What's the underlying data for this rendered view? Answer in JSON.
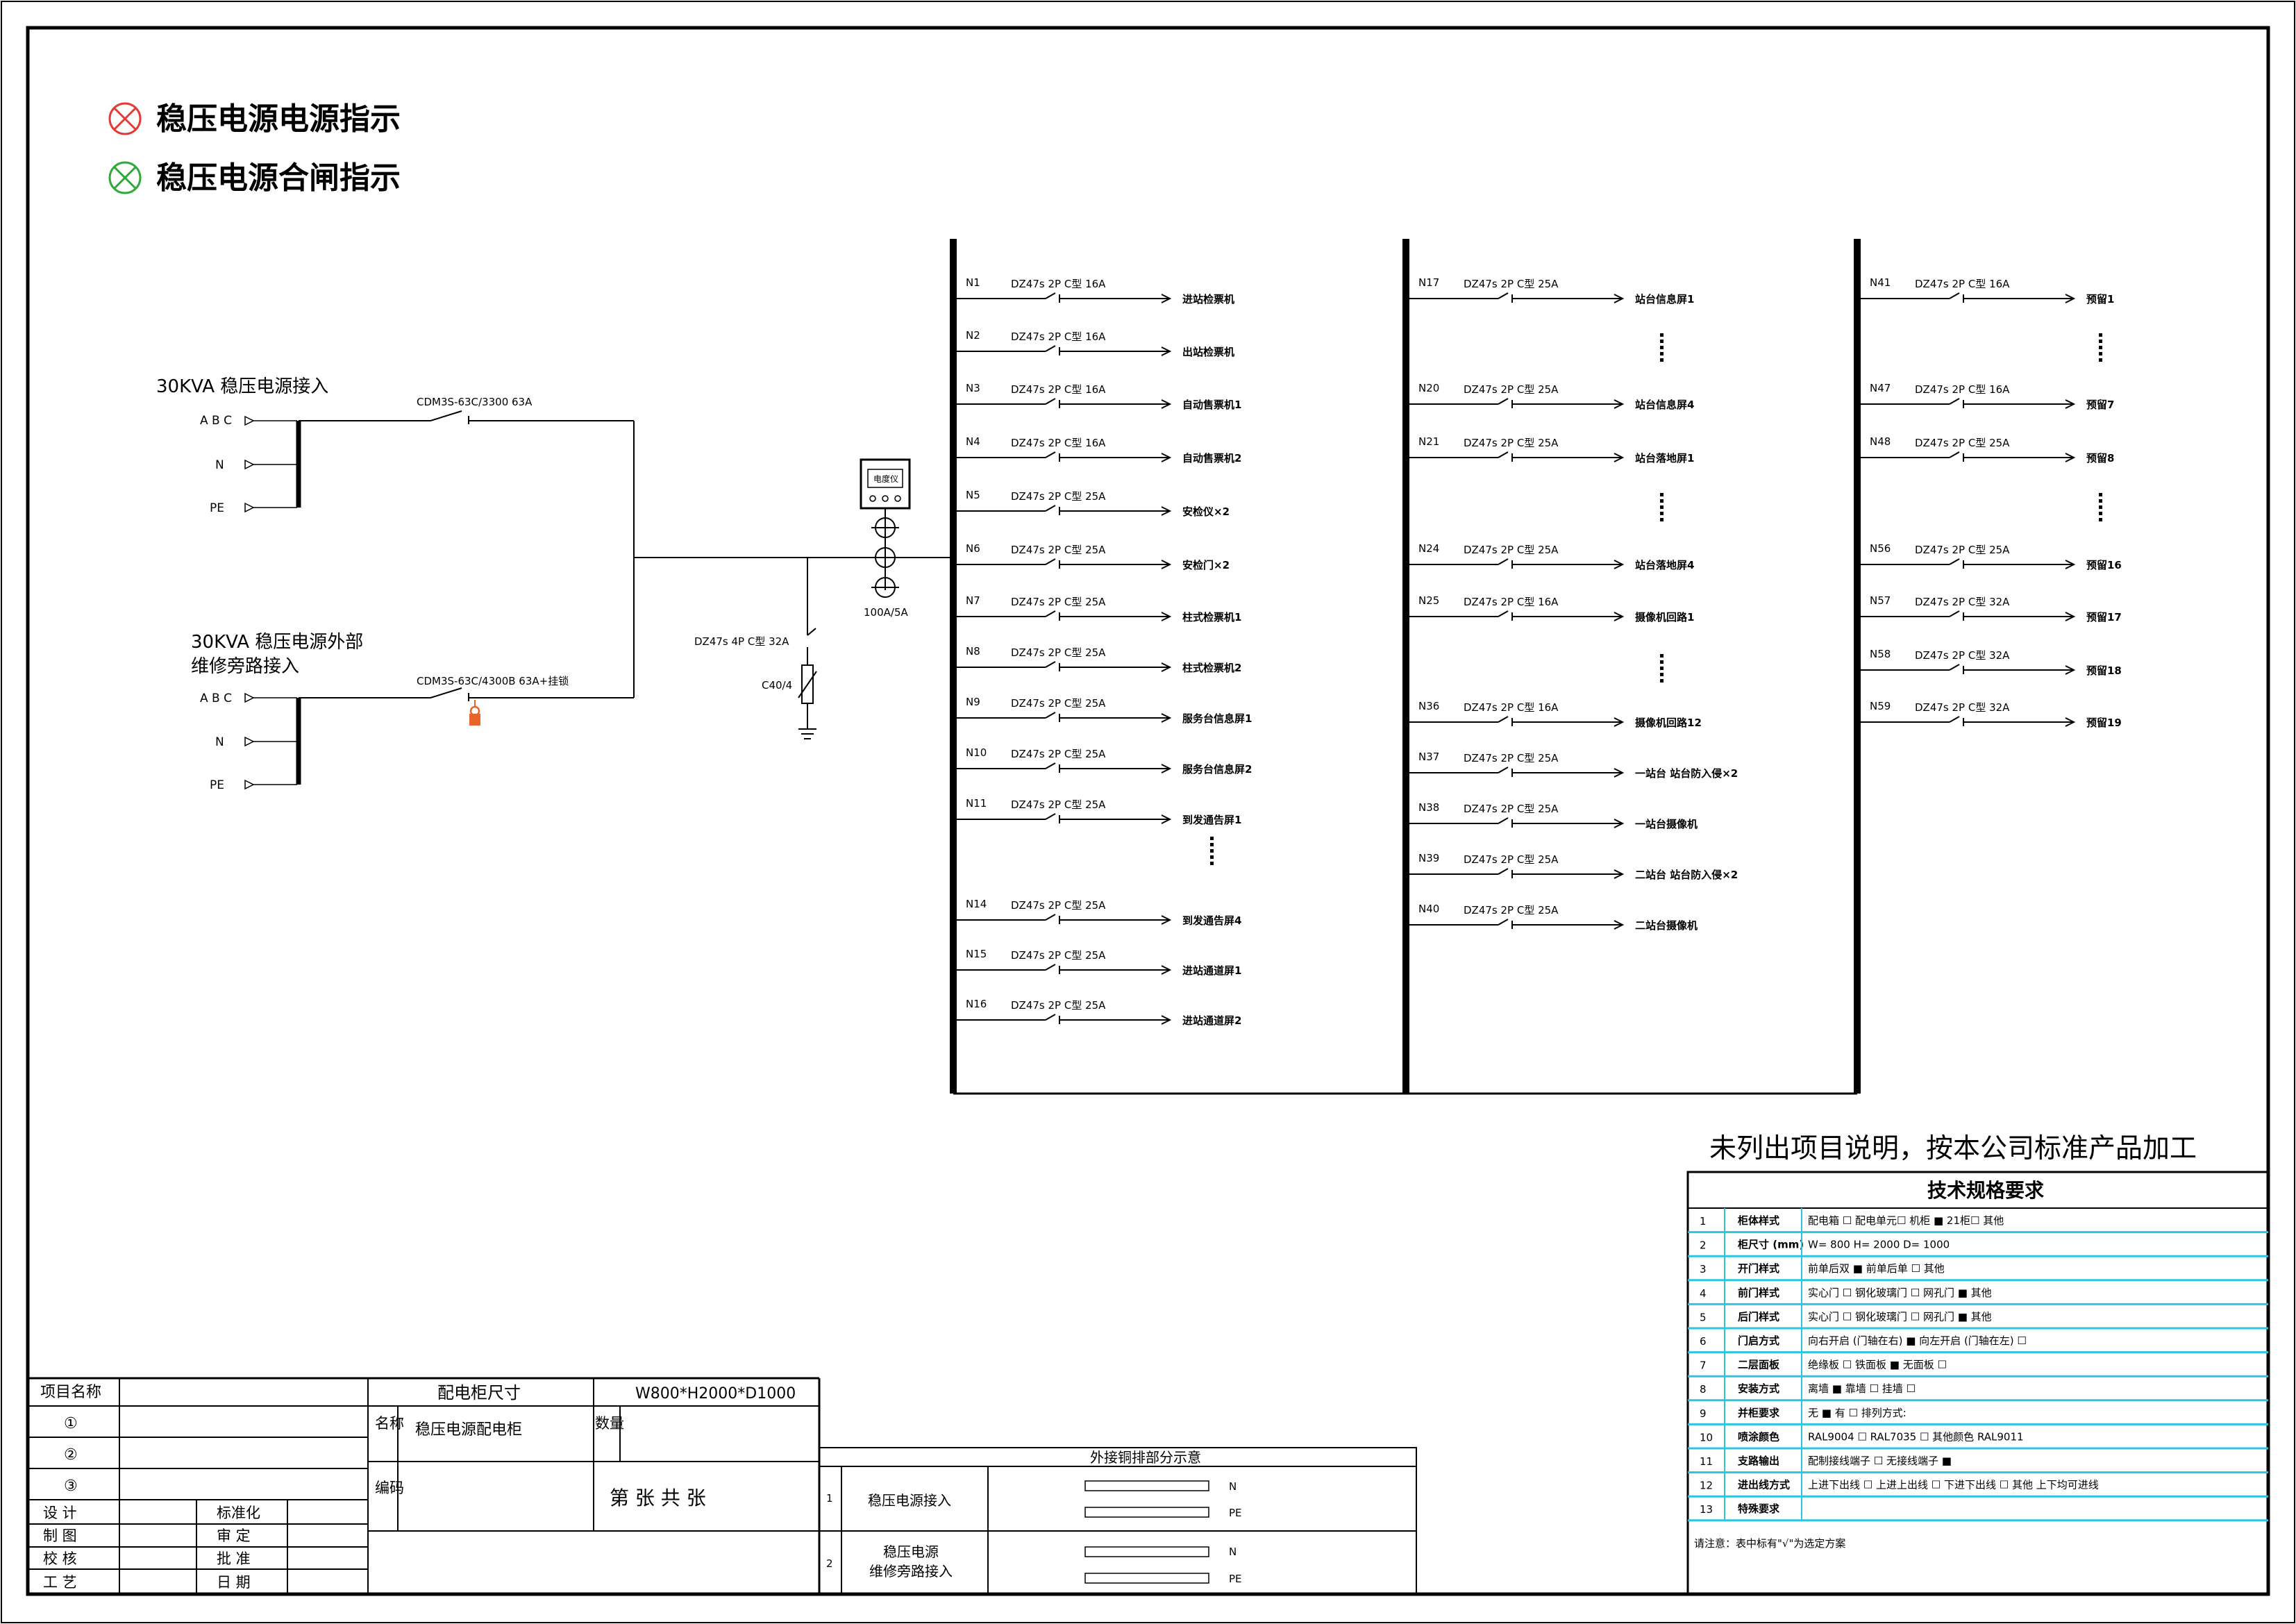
{
  "legend": [
    {
      "label": "稳压电源电源指示",
      "color": "#e53935"
    },
    {
      "label": "稳压电源合闸指示",
      "color": "#2eaa3a"
    }
  ],
  "sources": {
    "main_label": "30KVA 稳压电源接入",
    "bypass_label_line1": "30KVA 稳压电源外部",
    "bypass_label_line2": "维修旁路接入",
    "phase_abc": "A B C",
    "phase_n": "N",
    "phase_pe": "PE",
    "main_breaker": "CDM3S-63C/3300 63A",
    "bypass_breaker": "CDM3S-63C/4300B 63A+挂锁"
  },
  "spd": {
    "breaker": "DZ47s 4P C型 32A",
    "arrester": "C40/4"
  },
  "meter": {
    "label": "电度仪",
    "ct": "100A/5A"
  },
  "columns": [
    [
      {
        "id": "N1",
        "spec": "DZ47s  2P C型 16A",
        "label": "进站检票机"
      },
      {
        "id": "N2",
        "spec": "DZ47s  2P C型 16A",
        "label": "出站检票机"
      },
      {
        "id": "N3",
        "spec": "DZ47s  2P C型 16A",
        "label": "自动售票机1"
      },
      {
        "id": "N4",
        "spec": "DZ47s  2P C型 16A",
        "label": "自动售票机2"
      },
      {
        "id": "N5",
        "spec": "DZ47s  2P C型 25A",
        "label": "安检仪×2"
      },
      {
        "id": "N6",
        "spec": "DZ47s  2P C型 25A",
        "label": "安检门×2"
      },
      {
        "id": "N7",
        "spec": "DZ47s  2P C型 25A",
        "label": "柱式检票机1"
      },
      {
        "id": "N8",
        "spec": "DZ47s  2P C型 25A",
        "label": "柱式检票机2"
      },
      {
        "id": "N9",
        "spec": "DZ47s  2P C型 25A",
        "label": "服务台信息屏1"
      },
      {
        "id": "N10",
        "spec": "DZ47s  2P C型 25A",
        "label": "服务台信息屏2"
      },
      {
        "id": "N11",
        "spec": "DZ47s  2P C型 25A",
        "label": "到发通告屏1"
      },
      {
        "id": "N14",
        "spec": "DZ47s  2P C型 25A",
        "label": "到发通告屏4"
      },
      {
        "id": "N15",
        "spec": "DZ47s  2P C型 25A",
        "label": "进站通道屏1"
      },
      {
        "id": "N16",
        "spec": "DZ47s  2P C型 25A",
        "label": "进站通道屏2"
      }
    ],
    [
      {
        "id": "N17",
        "spec": "DZ47s  2P C型 25A",
        "label": "站台信息屏1"
      },
      {
        "id": "N20",
        "spec": "DZ47s  2P C型 25A",
        "label": "站台信息屏4"
      },
      {
        "id": "N21",
        "spec": "DZ47s  2P C型 25A",
        "label": "站台落地屏1"
      },
      {
        "id": "N24",
        "spec": "DZ47s  2P C型 25A",
        "label": "站台落地屏4"
      },
      {
        "id": "N25",
        "spec": "DZ47s  2P C型 16A",
        "label": "摄像机回路1"
      },
      {
        "id": "N36",
        "spec": "DZ47s  2P C型 16A",
        "label": "摄像机回路12"
      },
      {
        "id": "N37",
        "spec": "DZ47s  2P C型 25A",
        "label": "一站台 站台防入侵×2"
      },
      {
        "id": "N38",
        "spec": "DZ47s  2P C型 25A",
        "label": "一站台摄像机"
      },
      {
        "id": "N39",
        "spec": "DZ47s  2P C型 25A",
        "label": "二站台 站台防入侵×2"
      },
      {
        "id": "N40",
        "spec": "DZ47s  2P C型 25A",
        "label": "二站台摄像机"
      }
    ],
    [
      {
        "id": "N41",
        "spec": "DZ47s  2P C型 16A",
        "label": "预留1"
      },
      {
        "id": "N47",
        "spec": "DZ47s  2P C型 16A",
        "label": "预留7"
      },
      {
        "id": "N48",
        "spec": "DZ47s  2P C型 25A",
        "label": "预留8"
      },
      {
        "id": "N56",
        "spec": "DZ47s  2P C型 25A",
        "label": "预留16"
      },
      {
        "id": "N57",
        "spec": "DZ47s  2P C型 32A",
        "label": "预留17"
      },
      {
        "id": "N58",
        "spec": "DZ47s  2P C型 32A",
        "label": "预留18"
      },
      {
        "id": "N59",
        "spec": "DZ47s  2P C型 32A",
        "label": "预留19"
      }
    ]
  ],
  "note": "未列出项目说明，按本公司标准产品加工",
  "spec_table": {
    "title": "技术规格要求",
    "rows": [
      {
        "no": "1",
        "name": "柜体样式",
        "content": "配电箱 ☐   配电单元☐     机柜  ■   21柜☐  其他"
      },
      {
        "no": "2",
        "name": "柜尺寸 (mm)",
        "content": "W= 800    H= 2000   D= 1000"
      },
      {
        "no": "3",
        "name": "开门样式",
        "content": "前单后双 ■     前单后单 ☐     其他"
      },
      {
        "no": "4",
        "name": "前门样式",
        "content": "实心门   ☐   钢化玻璃门 ☐     网孔门 ■     其他"
      },
      {
        "no": "5",
        "name": "后门样式",
        "content": "实心门   ☐   钢化玻璃门 ☐     网孔门 ■     其他"
      },
      {
        "no": "6",
        "name": "门启方式",
        "content": "向右开启 (门轴在右)    ■    向左开启 (门轴在左) ☐"
      },
      {
        "no": "7",
        "name": "二层面板",
        "content": "绝缘板   ☐         铁面板 ■       无面板 ☐"
      },
      {
        "no": "8",
        "name": "安装方式",
        "content": "离墙     ■         靠墙   ☐       挂墙   ☐"
      },
      {
        "no": "9",
        "name": "并柜要求",
        "content": "   无     ■          有  ☐  排列方式:"
      },
      {
        "no": "10",
        "name": "喷涂颜色",
        "content": "RAL9004 ☐         RAL7035   ☐ 其他颜色   RAL9011"
      },
      {
        "no": "11",
        "name": "支路输出",
        "content": "配制接线端子  ☐   无接线端子  ■"
      },
      {
        "no": "12",
        "name": "进出线方式",
        "content": "上进下出线   ☐   上进上出线  ☐    下进下出线  ☐     其他  上下均可进线"
      },
      {
        "no": "13",
        "name": "特殊要求",
        "content": ""
      }
    ],
    "footnote": "请注意：表中标有\"√\"为选定方案"
  },
  "title_block": {
    "project_name_label": "项目名称",
    "circle1": "①",
    "circle2": "②",
    "circle3": "③",
    "design": "设    计",
    "draw": "制    图",
    "check": "校    核",
    "craft": "工    艺",
    "standard": "标准化",
    "review": "审    定",
    "approve": "批    准",
    "date": "日    期",
    "cabinet_size_label": "配电柜尺寸",
    "cabinet_size_value": "W800*H2000*D1000",
    "name_label": "名称",
    "name_value": "稳压电源配电柜",
    "qty_label": "数量",
    "code_label": "编码",
    "sheet_text": "第      张 共      张"
  },
  "copper_table": {
    "title": "外接铜排部分示意",
    "rows": [
      {
        "no": "1",
        "name": "稳压电源接入",
        "n": "N",
        "pe": "PE"
      },
      {
        "no": "2",
        "name_line1": "稳压电源",
        "name_line2": "维修旁路接入",
        "n": "N",
        "pe": "PE"
      }
    ]
  }
}
